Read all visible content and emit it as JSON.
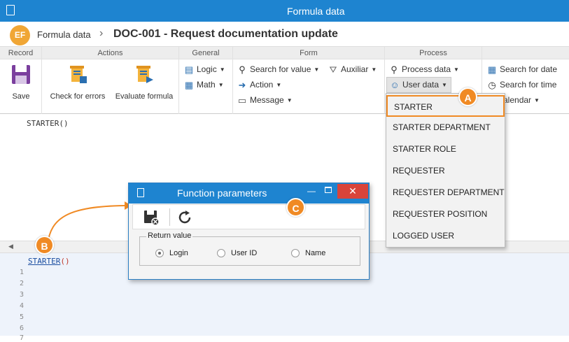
{
  "window": {
    "title": "Formula data"
  },
  "breadcrumb": {
    "logo_text": "EF",
    "parent": "Formula data",
    "separator": "›",
    "current": "DOC-001 - Request documentation update"
  },
  "ribbon": {
    "groups": {
      "record": "Record",
      "actions": "Actions",
      "general": "General",
      "form": "Form",
      "process": "Process"
    },
    "save": "Save",
    "check_errors": "Check for errors",
    "evaluate_formula": "Evaluate formula",
    "logic": "Logic",
    "math": "Math",
    "search_for_value": "Search for value",
    "auxiliar": "Auxiliar",
    "action": "Action",
    "message": "Message",
    "process_data": "Process data",
    "user_data": "User data",
    "search_for_date": "Search for date",
    "search_for_time": "Search for time",
    "calendar": "alendar"
  },
  "editor": {
    "text": "STARTER()"
  },
  "code": {
    "keyword": "STARTER",
    "parens": "()",
    "line_numbers": [
      "1",
      "2",
      "3",
      "4",
      "5",
      "6",
      "7"
    ]
  },
  "user_data_menu": {
    "items": [
      "STARTER",
      "STARTER DEPARTMENT",
      "STARTER ROLE",
      "REQUESTER",
      "REQUESTER DEPARTMENT",
      "REQUESTER POSITION",
      "LOGGED USER"
    ],
    "selected": "STARTER"
  },
  "dialog": {
    "title": "Function parameters",
    "close": "✕",
    "minimize": "—",
    "return_value_label": "Return value",
    "options": [
      "Login",
      "User ID",
      "Name"
    ],
    "selected": "Login"
  },
  "callouts": {
    "a": "A",
    "b": "B",
    "c": "C"
  },
  "colors": {
    "titlebar": "#1e84d0",
    "accent": "#f08a24",
    "close": "#d9443a"
  }
}
